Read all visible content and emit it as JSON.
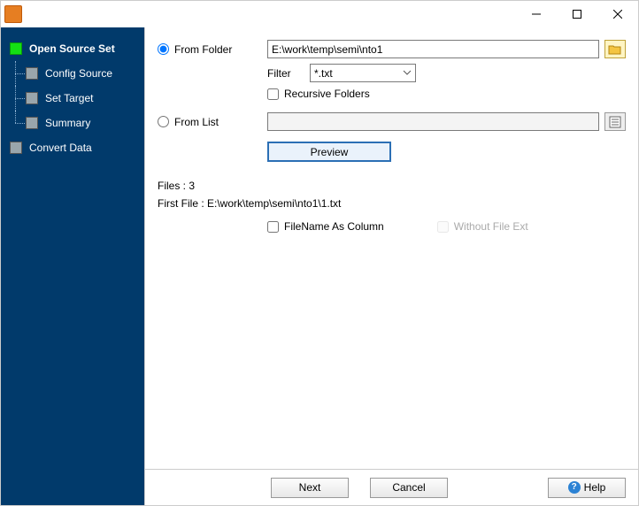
{
  "sidebar": {
    "items": [
      {
        "label": "Open Source Set",
        "active": true
      },
      {
        "label": "Config Source"
      },
      {
        "label": "Set Target"
      },
      {
        "label": "Summary"
      },
      {
        "label": "Convert Data"
      }
    ]
  },
  "form": {
    "from_folder_label": "From Folder",
    "folder_path_value": "E:\\work\\temp\\semi\\nto1",
    "filter_label": "Filter",
    "filter_value": "*.txt",
    "recursive_label": "Recursive Folders",
    "from_list_label": "From List",
    "list_path_value": "",
    "preview_label": "Preview",
    "files_count_label": "Files : 3",
    "first_file_label": "First File : E:\\work\\temp\\semi\\nto1\\1.txt",
    "filename_as_column_label": "FileName As Column",
    "without_ext_label": "Without File Ext"
  },
  "buttons": {
    "next": "Next",
    "cancel": "Cancel",
    "help": "Help"
  }
}
